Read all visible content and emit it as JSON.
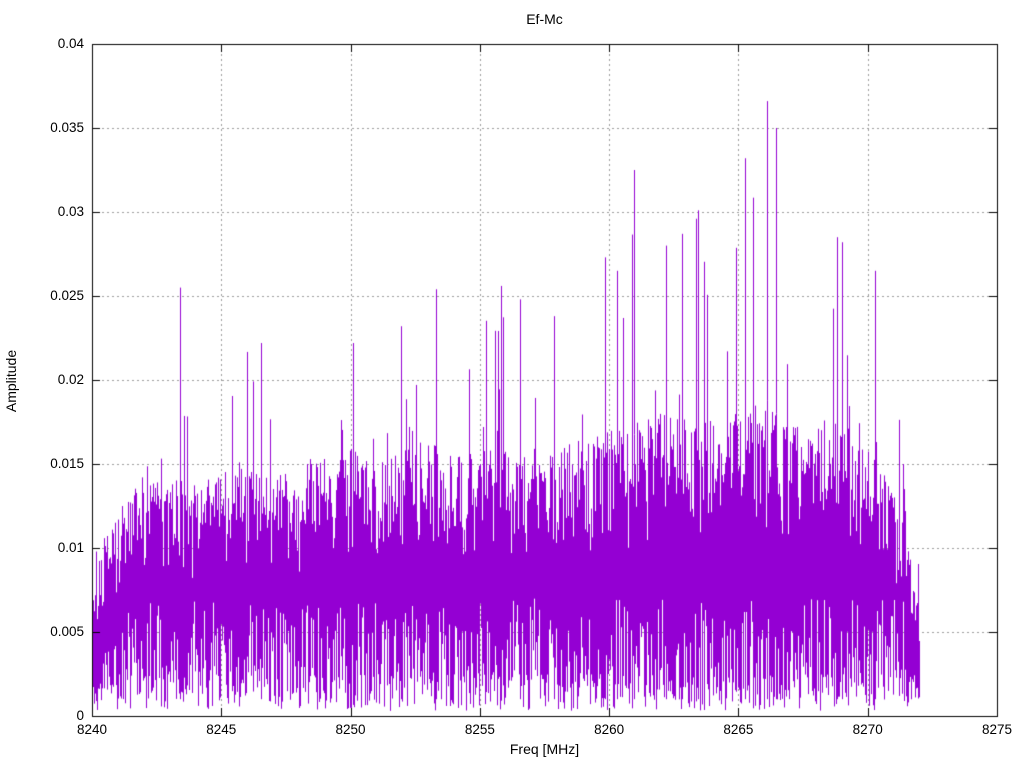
{
  "chart_data": {
    "type": "line",
    "title": "Ef-Mc",
    "xlabel": "Freq [MHz]",
    "ylabel": "Amplitude",
    "xlim": [
      8240,
      8275
    ],
    "ylim": [
      0,
      0.04
    ],
    "x_ticks": [
      8240,
      8245,
      8250,
      8255,
      8260,
      8265,
      8270,
      8275
    ],
    "x_tick_labels": [
      "8240",
      "8245",
      "8250",
      "8255",
      "8260",
      "8265",
      "8270",
      "8275"
    ],
    "y_ticks": [
      0,
      0.005,
      0.01,
      0.015,
      0.02,
      0.025,
      0.03,
      0.035,
      0.04
    ],
    "y_tick_labels": [
      "0",
      "0.005",
      "0.01",
      "0.015",
      "0.02",
      "0.025",
      "0.03",
      "0.035",
      "0.04"
    ],
    "grid": true,
    "grid_style": "dotted-gray",
    "line_color": "#9400d3",
    "grid_color": "#9c9c9c",
    "border_color": "#000000",
    "signal": {
      "freq_start": 8240,
      "freq_end": 8272,
      "envelope_freqs": [
        8240,
        8240.4,
        8241,
        8242,
        8243,
        8244,
        8245,
        8246,
        8247,
        8248,
        8249,
        8250,
        8251,
        8252,
        8253,
        8254,
        8255,
        8256,
        8257,
        8258,
        8259,
        8260,
        8261,
        8262,
        8263,
        8264,
        8265,
        8266,
        8267,
        8268,
        8269,
        8270,
        8271,
        8271.6,
        8272
      ],
      "envelope_mass_top": [
        0.007,
        0.009,
        0.0115,
        0.0125,
        0.013,
        0.0125,
        0.013,
        0.0135,
        0.013,
        0.0135,
        0.014,
        0.0145,
        0.014,
        0.0145,
        0.015,
        0.014,
        0.0145,
        0.015,
        0.0145,
        0.0145,
        0.015,
        0.0155,
        0.016,
        0.0165,
        0.016,
        0.016,
        0.0165,
        0.017,
        0.016,
        0.016,
        0.016,
        0.0145,
        0.0125,
        0.009,
        0.0045
      ],
      "envelope_peak": [
        0.011,
        0.0135,
        0.0145,
        0.021,
        0.0255,
        0.0192,
        0.0195,
        0.0222,
        0.0205,
        0.0202,
        0.022,
        0.0222,
        0.0232,
        0.024,
        0.0256,
        0.024,
        0.0256,
        0.0248,
        0.0238,
        0.0205,
        0.0273,
        0.0265,
        0.0325,
        0.0287,
        0.0301,
        0.027,
        0.0332,
        0.0366,
        0.025,
        0.0285,
        0.0282,
        0.0265,
        0.0225,
        0.014,
        0.0098
      ],
      "mass_bottom_typical": 0.002,
      "notable_peaks": [
        [
          8243.4,
          0.0255
        ],
        [
          8246.55,
          0.0222
        ],
        [
          8250.1,
          0.0222
        ],
        [
          8251.95,
          0.0232
        ],
        [
          8253.3,
          0.0254
        ],
        [
          8255.8,
          0.0256
        ],
        [
          8256.55,
          0.0248
        ],
        [
          8257.85,
          0.0238
        ],
        [
          8259.85,
          0.0273
        ],
        [
          8260.3,
          0.0265
        ],
        [
          8260.95,
          0.0325
        ],
        [
          8262.2,
          0.028
        ],
        [
          8262.8,
          0.0287
        ],
        [
          8263.35,
          0.0296
        ],
        [
          8263.45,
          0.0301
        ],
        [
          8265.25,
          0.0332
        ],
        [
          8266.1,
          0.0366
        ],
        [
          8266.45,
          0.035
        ],
        [
          8268.8,
          0.0285
        ],
        [
          8269.0,
          0.0282
        ],
        [
          8270.3,
          0.0265
        ]
      ],
      "render_seed": 42
    }
  }
}
